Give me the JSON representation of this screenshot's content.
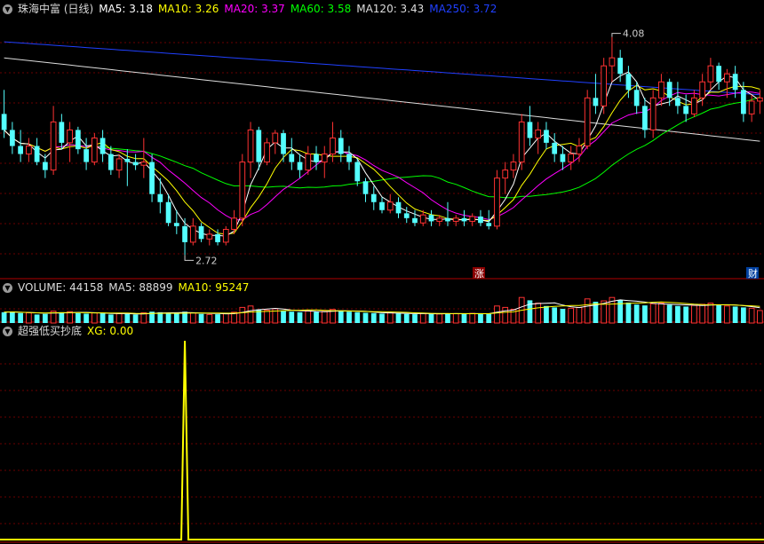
{
  "stock": {
    "title": "珠海中富 (日线)"
  },
  "main_legend": [
    {
      "label": "MA5: 3.18",
      "color": "#ffffff"
    },
    {
      "label": "MA10: 3.26",
      "color": "#ffff00"
    },
    {
      "label": "MA20: 3.37",
      "color": "#ff00ff"
    },
    {
      "label": "MA60: 3.58",
      "color": "#00ff00"
    },
    {
      "label": "MA120: 3.43",
      "color": "#dddddd"
    },
    {
      "label": "MA250: 3.72",
      "color": "#2040ff"
    }
  ],
  "volume_legend": [
    {
      "label": "VOLUME: 44158",
      "color": "#dddddd"
    },
    {
      "label": "MA5: 88899",
      "color": "#dddddd"
    },
    {
      "label": "MA10: 95247",
      "color": "#ffff00"
    }
  ],
  "indicator": {
    "name": "超强低买抄底",
    "xg_label": "XG: 0.00",
    "xg_color": "#ffff00"
  },
  "annotations": {
    "high": "4.08",
    "low": "2.72",
    "zhang": "涨",
    "cai": "财"
  },
  "colors": {
    "up": "#ff3232",
    "down": "#54ffff",
    "background": "#000000",
    "grid": "#8b0000"
  },
  "chart_data": [
    {
      "type": "candlestick",
      "price_range": [
        2.65,
        4.2
      ],
      "ohlc": [
        [
          3.6,
          3.75,
          3.45,
          3.5
        ],
        [
          3.5,
          3.55,
          3.35,
          3.4
        ],
        [
          3.4,
          3.5,
          3.3,
          3.35
        ],
        [
          3.35,
          3.45,
          3.3,
          3.4
        ],
        [
          3.4,
          3.45,
          3.28,
          3.3
        ],
        [
          3.3,
          3.35,
          3.2,
          3.25
        ],
        [
          3.25,
          3.65,
          3.22,
          3.55
        ],
        [
          3.55,
          3.6,
          3.38,
          3.42
        ],
        [
          3.42,
          3.55,
          3.3,
          3.5
        ],
        [
          3.5,
          3.52,
          3.35,
          3.38
        ],
        [
          3.38,
          3.45,
          3.25,
          3.3
        ],
        [
          3.3,
          3.48,
          3.28,
          3.45
        ],
        [
          3.45,
          3.5,
          3.3,
          3.35
        ],
        [
          3.35,
          3.4,
          3.22,
          3.25
        ],
        [
          3.25,
          3.35,
          3.2,
          3.32
        ],
        [
          3.32,
          3.38,
          3.15,
          3.3
        ],
        [
          3.3,
          3.35,
          3.25,
          3.28
        ],
        [
          3.28,
          3.45,
          3.2,
          3.3
        ],
        [
          3.3,
          3.35,
          3.05,
          3.1
        ],
        [
          3.1,
          3.2,
          2.98,
          3.05
        ],
        [
          3.05,
          3.1,
          2.9,
          2.92
        ],
        [
          2.92,
          3.0,
          2.85,
          2.9
        ],
        [
          2.9,
          2.95,
          2.72,
          2.8
        ],
        [
          2.8,
          2.95,
          2.78,
          2.9
        ],
        [
          2.9,
          2.92,
          2.8,
          2.82
        ],
        [
          2.82,
          2.88,
          2.78,
          2.85
        ],
        [
          2.85,
          2.88,
          2.78,
          2.8
        ],
        [
          2.8,
          2.9,
          2.78,
          2.88
        ],
        [
          2.88,
          3.0,
          2.85,
          2.95
        ],
        [
          2.95,
          3.35,
          2.9,
          3.3
        ],
        [
          3.3,
          3.55,
          3.2,
          3.5
        ],
        [
          3.5,
          3.52,
          3.25,
          3.3
        ],
        [
          3.3,
          3.45,
          3.28,
          3.42
        ],
        [
          3.42,
          3.5,
          3.35,
          3.48
        ],
        [
          3.48,
          3.5,
          3.3,
          3.35
        ],
        [
          3.35,
          3.45,
          3.25,
          3.3
        ],
        [
          3.3,
          3.35,
          3.2,
          3.25
        ],
        [
          3.25,
          3.4,
          3.22,
          3.35
        ],
        [
          3.35,
          3.4,
          3.25,
          3.3
        ],
        [
          3.3,
          3.4,
          3.2,
          3.35
        ],
        [
          3.35,
          3.55,
          3.3,
          3.45
        ],
        [
          3.45,
          3.5,
          3.3,
          3.35
        ],
        [
          3.35,
          3.4,
          3.25,
          3.3
        ],
        [
          3.3,
          3.32,
          3.15,
          3.18
        ],
        [
          3.18,
          3.2,
          3.05,
          3.1
        ],
        [
          3.1,
          3.15,
          3.0,
          3.05
        ],
        [
          3.05,
          3.08,
          2.98,
          3.0
        ],
        [
          3.0,
          3.1,
          2.98,
          3.05
        ],
        [
          3.05,
          3.08,
          2.95,
          2.98
        ],
        [
          2.98,
          3.02,
          2.92,
          2.95
        ],
        [
          2.95,
          3.0,
          2.9,
          2.92
        ],
        [
          2.92,
          3.0,
          2.9,
          2.97
        ],
        [
          2.97,
          3.0,
          2.9,
          2.93
        ],
        [
          2.93,
          2.97,
          2.9,
          2.95
        ],
        [
          2.95,
          3.05,
          2.9,
          2.93
        ],
        [
          2.93,
          2.97,
          2.9,
          2.95
        ],
        [
          2.95,
          3.0,
          2.9,
          2.93
        ],
        [
          2.93,
          2.98,
          2.9,
          2.96
        ],
        [
          2.96,
          3.0,
          2.9,
          2.92
        ],
        [
          2.92,
          3.0,
          2.88,
          2.9
        ],
        [
          2.9,
          3.25,
          2.88,
          3.2
        ],
        [
          3.2,
          3.3,
          3.1,
          3.25
        ],
        [
          3.25,
          3.35,
          3.2,
          3.3
        ],
        [
          3.3,
          3.6,
          3.25,
          3.55
        ],
        [
          3.55,
          3.65,
          3.4,
          3.45
        ],
        [
          3.45,
          3.55,
          3.35,
          3.5
        ],
        [
          3.5,
          3.55,
          3.38,
          3.42
        ],
        [
          3.42,
          3.48,
          3.3,
          3.35
        ],
        [
          3.35,
          3.4,
          3.25,
          3.3
        ],
        [
          3.3,
          3.4,
          3.25,
          3.35
        ],
        [
          3.35,
          3.45,
          3.3,
          3.4
        ],
        [
          3.4,
          3.75,
          3.38,
          3.7
        ],
        [
          3.7,
          3.85,
          3.6,
          3.65
        ],
        [
          3.65,
          3.95,
          3.6,
          3.9
        ],
        [
          3.9,
          4.08,
          3.8,
          3.95
        ],
        [
          3.95,
          4.0,
          3.8,
          3.85
        ],
        [
          3.85,
          3.9,
          3.7,
          3.75
        ],
        [
          3.75,
          3.8,
          3.6,
          3.65
        ],
        [
          3.65,
          3.7,
          3.45,
          3.5
        ],
        [
          3.5,
          3.75,
          3.45,
          3.7
        ],
        [
          3.7,
          3.85,
          3.65,
          3.8
        ],
        [
          3.8,
          3.82,
          3.65,
          3.7
        ],
        [
          3.7,
          3.8,
          3.6,
          3.65
        ],
        [
          3.65,
          3.72,
          3.55,
          3.6
        ],
        [
          3.6,
          3.75,
          3.58,
          3.7
        ],
        [
          3.7,
          3.85,
          3.65,
          3.8
        ],
        [
          3.8,
          3.95,
          3.75,
          3.9
        ],
        [
          3.9,
          3.92,
          3.75,
          3.8
        ],
        [
          3.8,
          3.88,
          3.7,
          3.85
        ],
        [
          3.85,
          3.9,
          3.7,
          3.75
        ],
        [
          3.75,
          3.8,
          3.55,
          3.6
        ],
        [
          3.6,
          3.72,
          3.55,
          3.68
        ],
        [
          3.68,
          3.75,
          3.6,
          3.7
        ]
      ],
      "ma": {
        "MA250": [
          4.05,
          3.72
        ],
        "MA120": [
          3.95,
          3.43
        ],
        "MA60": [
          3.75,
          3.58
        ],
        "MA20": [
          3.65,
          3.37
        ],
        "MA10": [
          3.55,
          3.26
        ],
        "MA5": [
          3.55,
          3.18
        ]
      },
      "annotations": [
        "4.08",
        "2.72",
        "涨",
        "财"
      ]
    },
    {
      "type": "bar",
      "title": "VOLUME",
      "values": [
        38,
        40,
        35,
        36,
        30,
        32,
        42,
        38,
        40,
        35,
        33,
        36,
        34,
        30,
        33,
        32,
        30,
        36,
        40,
        38,
        35,
        33,
        40,
        36,
        32,
        30,
        31,
        33,
        38,
        55,
        60,
        48,
        45,
        50,
        44,
        40,
        38,
        42,
        39,
        41,
        48,
        44,
        40,
        38,
        36,
        35,
        33,
        36,
        34,
        32,
        31,
        34,
        33,
        32,
        34,
        33,
        32,
        34,
        33,
        32,
        60,
        55,
        48,
        90,
        80,
        70,
        60,
        55,
        50,
        52,
        55,
        85,
        75,
        78,
        90,
        80,
        72,
        65,
        62,
        68,
        70,
        64,
        60,
        58,
        62,
        66,
        70,
        64,
        60,
        58,
        55,
        52,
        44
      ],
      "MA5": 88899,
      "MA10": 95247
    },
    {
      "type": "line",
      "title": "超强低买抄底",
      "series": [
        {
          "name": "XG",
          "signal_index": 22,
          "signal_value": 1,
          "baseline": 0
        }
      ],
      "ylim": [
        0,
        1
      ]
    }
  ]
}
